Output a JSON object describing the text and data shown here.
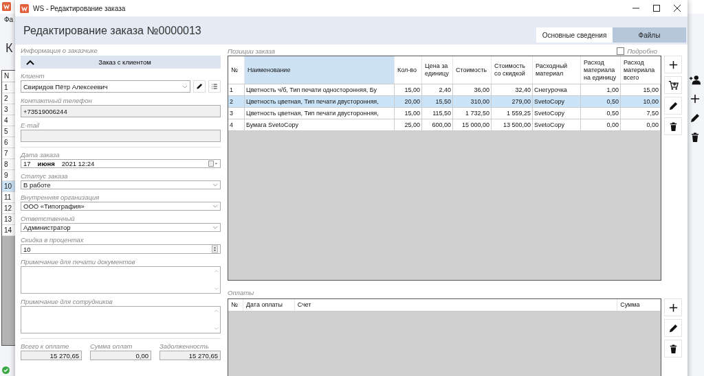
{
  "background_window": {
    "menu_fragment": "Фа",
    "heading_fragment": "К",
    "list_header": "N",
    "list_items": [
      {
        "label": "1",
        "selected": false
      },
      {
        "label": "2",
        "selected": false
      },
      {
        "label": "3",
        "selected": false
      },
      {
        "label": "4",
        "selected": false
      },
      {
        "label": "5",
        "selected": false
      },
      {
        "label": "6",
        "selected": false
      },
      {
        "label": "7",
        "selected": false
      },
      {
        "label": "8",
        "selected": false
      },
      {
        "label": "9",
        "selected": false
      },
      {
        "label": "10",
        "selected": true
      },
      {
        "label": "11",
        "selected": false
      },
      {
        "label": "12",
        "selected": false
      },
      {
        "label": "13",
        "selected": false
      },
      {
        "label": "14",
        "selected": false
      }
    ]
  },
  "dialog": {
    "title": "WS - Редактирование заказа",
    "heading": "Редактирование заказа №0000013",
    "tabs": [
      {
        "label": "Основные сведения",
        "selected": true
      },
      {
        "label": "Файлы",
        "selected": false
      }
    ]
  },
  "customer": {
    "section_label": "Информация о заказчике",
    "collapse_label": "Заказ с клиентом",
    "expanded": true,
    "fields": [
      {
        "kind": "client",
        "label": "Клиент",
        "value": "Свиридов Пётр Алексеевич"
      },
      {
        "kind": "readonly",
        "label": "Контактный телефон",
        "value": "+73519006244"
      },
      {
        "kind": "readonly",
        "label": "E-mail"
      }
    ]
  },
  "order_fields": [
    {
      "kind": "date",
      "label": "Дата заказа",
      "parts": [
        "17",
        "июня",
        "2021 12:24"
      ]
    },
    {
      "kind": "combo",
      "label": "Статус заказа",
      "value": "В работе"
    },
    {
      "kind": "combo",
      "label": "Внутренняя организация",
      "value": "ООО «Типография»"
    },
    {
      "kind": "combo",
      "label": "Ответственный",
      "value": "Администратор"
    },
    {
      "kind": "spin",
      "label": "Скидка в процентах",
      "value": "10"
    },
    {
      "kind": "memo",
      "label": "Примечание для печати документов"
    },
    {
      "kind": "memo",
      "label": "Примечание для сотрудников"
    }
  ],
  "totals": [
    {
      "label": "Всего к оплате",
      "value": "15 270,65"
    },
    {
      "label": "Сумма оплат",
      "value": "0,00"
    },
    {
      "label": "Задолженность",
      "value": "15 270,65"
    }
  ],
  "order_items": {
    "label": "Позиции заказа",
    "detailed": {
      "label": "Подробно",
      "checked": false
    },
    "columns": [
      {
        "label": "№",
        "sorted": false
      },
      {
        "label": "Наименование",
        "sorted": true
      },
      {
        "label": "Кол-во",
        "sorted": false
      },
      {
        "label": "Цена за единицу",
        "sorted": false
      },
      {
        "label": "Стоимость",
        "sorted": false
      },
      {
        "label": "Стоимость со скидкой",
        "sorted": false
      },
      {
        "label": "Расходный материал",
        "sorted": false
      },
      {
        "label": "Расход материала на единицу",
        "sorted": false
      },
      {
        "label": "Расход материала всего",
        "sorted": false
      }
    ],
    "rows": [
      {
        "selected": false,
        "cells": [
          "1",
          "Цветность ч/б, Тип печати односторонняя, Бу",
          "15,00",
          "2,40",
          "36,00",
          "32,40",
          "Снегурочка",
          "1,00",
          "15,00"
        ]
      },
      {
        "selected": true,
        "cells": [
          "2",
          "Цветность цветная, Тип печати двусторонняя,",
          "20,00",
          "15,50",
          "310,00",
          "279,00",
          "SvetoCopy",
          "0,50",
          "10,00"
        ]
      },
      {
        "selected": false,
        "cells": [
          "3",
          "Цветность цветная, Тип печати двусторонняя,",
          "15,00",
          "115,50",
          "1 732,50",
          "1 559,25",
          "SvetoCopy",
          "0,50",
          "7,50"
        ]
      },
      {
        "selected": false,
        "cells": [
          "4",
          "Бумага SvetoCopy",
          "25,00",
          "600,00",
          "15 000,00",
          "13 500,00",
          "SvetoCopy",
          "0,00",
          "0,00"
        ]
      }
    ]
  },
  "payments": {
    "label": "Оплаты",
    "columns": [
      "№",
      "Дата оплаты",
      "Счет",
      "Сумма"
    ]
  }
}
